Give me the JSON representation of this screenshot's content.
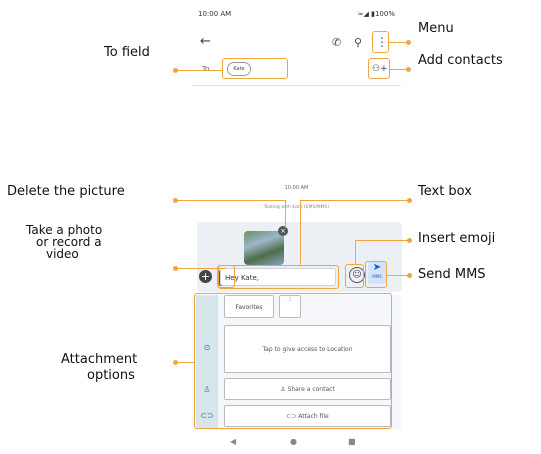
{
  "status_bar": {
    "time": "10:00 AM",
    "right": "≈◢ ▮100%"
  },
  "header": {
    "back_icon": "arrow-left-icon",
    "call_icon": "phone-icon",
    "search_icon": "search-icon",
    "menu_icon": "more-vert-icon"
  },
  "to_row": {
    "label": "To",
    "chip": "Kate",
    "add_contacts_icon": "add-person-icon"
  },
  "conversation": {
    "timestamp": "10:00 AM",
    "texting_with": "Texting with Kate (SMS/MMS)"
  },
  "compose": {
    "text": "Hey Kate,",
    "send_label": "MMS"
  },
  "attachments": {
    "favorites": "Favorites",
    "location": "Tap to give access to Location",
    "share_contact": "Share a contact",
    "attach_file": "Attach file"
  },
  "callouts": {
    "menu": "Menu",
    "to_field": "To field",
    "add_contacts": "Add contacts",
    "delete_picture": "Delete the picture",
    "text_box": "Text box",
    "take_photo": [
      "Take a photo",
      "or record a",
      "video"
    ],
    "insert_emoji": "Insert emoji",
    "send_mms": "Send MMS",
    "attachment_options": [
      "Attachment",
      "options"
    ]
  },
  "colors": {
    "accent": "#f0a640",
    "send_bg": "#d4e3f8",
    "strip": "#d6e6ea"
  }
}
